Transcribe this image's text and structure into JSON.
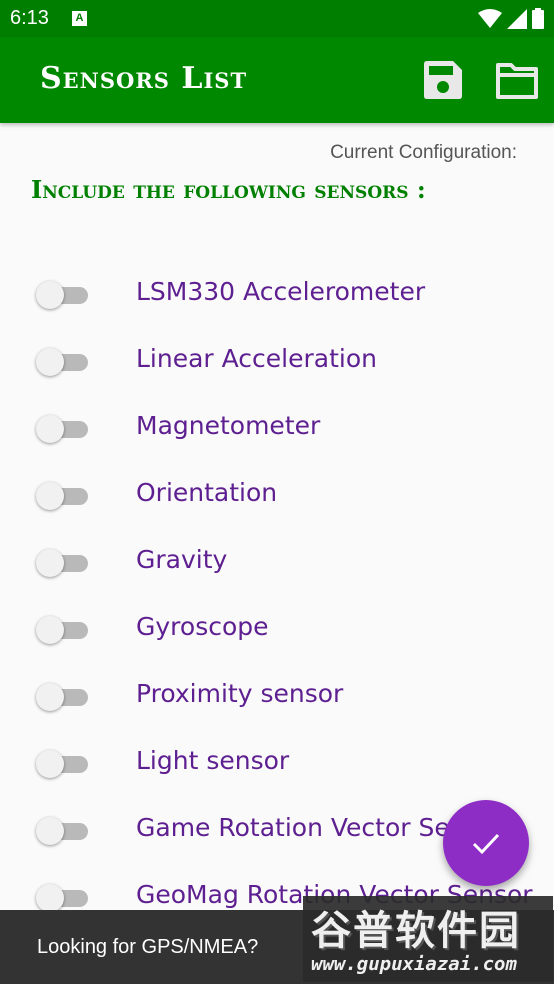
{
  "status_bar": {
    "time": "6:13",
    "notification_icon": "A"
  },
  "app_bar": {
    "title": "Sensors List",
    "actions": [
      {
        "icon": "save-icon"
      },
      {
        "icon": "folder-icon"
      }
    ]
  },
  "config": {
    "current_label": "Current Configuration:",
    "heading": "Include the following sensors :"
  },
  "sensors": [
    {
      "label": "LSM330 Accelerometer",
      "enabled": false
    },
    {
      "label": "Linear Acceleration",
      "enabled": false
    },
    {
      "label": "Magnetometer",
      "enabled": false
    },
    {
      "label": "Orientation",
      "enabled": false
    },
    {
      "label": "Gravity",
      "enabled": false
    },
    {
      "label": "Gyroscope",
      "enabled": false
    },
    {
      "label": "Proximity sensor",
      "enabled": false
    },
    {
      "label": "Light sensor",
      "enabled": false
    },
    {
      "label": "Game Rotation Vector Sensor",
      "enabled": false
    },
    {
      "label": "GeoMag Rotation Vector Sensor",
      "enabled": false
    }
  ],
  "fab": {
    "icon": "check-icon"
  },
  "snackbar": {
    "text": "Looking for GPS/NMEA?"
  },
  "watermark": {
    "logo": "谷普软件园",
    "url": "www.gupuxiazai.com"
  },
  "colors": {
    "app_bar": "#008800",
    "status_bar": "#007e00",
    "heading": "#008000",
    "sensor_label": "#5e2091",
    "fab": "#8e2cc6",
    "snackbar": "#333333"
  }
}
